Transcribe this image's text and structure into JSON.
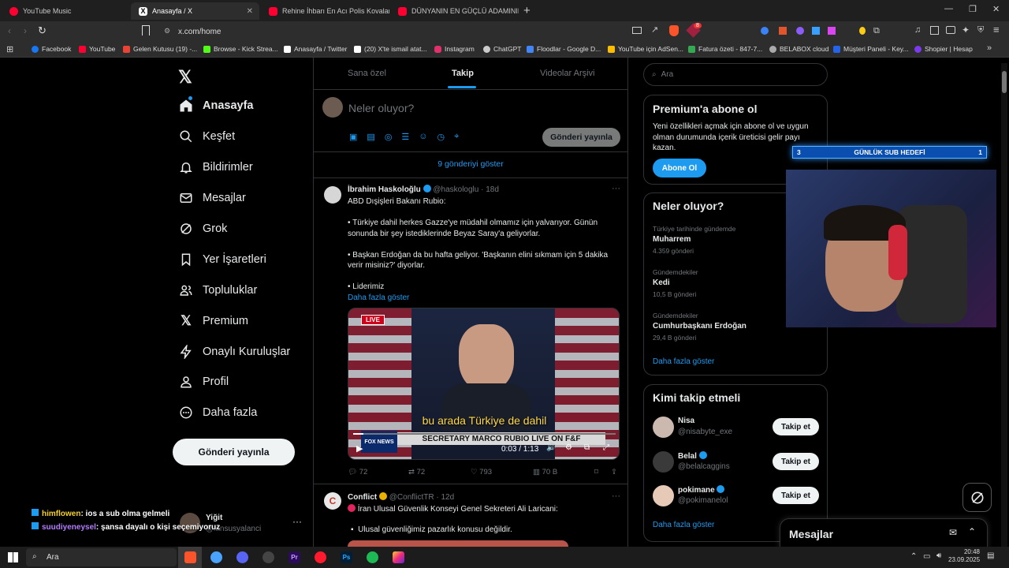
{
  "browser": {
    "tabs": [
      {
        "label": "YouTube Music",
        "color": "#ff0033"
      },
      {
        "label": "Anasayfa / X",
        "color": "#ffffff"
      },
      {
        "label": "Rehine İhbarı En Acı Polis Kovalamac",
        "color": "#ff0033"
      },
      {
        "label": "DÜNYANIN EN GÜÇLÜ ADAMININ AF",
        "color": "#ff0033"
      }
    ],
    "url": "x.com/home",
    "notif_count": "8",
    "bookmarks": [
      "Facebook",
      "YouTube",
      "Gelen Kutusu (19) -...",
      "Browse - Kick Strea...",
      "Anasayfa / Twitter",
      "(20) X'te ismail atat...",
      "Instagram",
      "ChatGPT",
      "Floodlar - Google D...",
      "YouTube için AdSen...",
      "Fatura özeti - 847-7...",
      "BELABOX cloud",
      "Müşteri Paneli - Key...",
      "Shopier | Hesap"
    ]
  },
  "nav": {
    "items": [
      {
        "label": "Anasayfa",
        "icon": "home-icon"
      },
      {
        "label": "Keşfet",
        "icon": "search-icon"
      },
      {
        "label": "Bildirimler",
        "icon": "bell-icon"
      },
      {
        "label": "Mesajlar",
        "icon": "mail-icon"
      },
      {
        "label": "Grok",
        "icon": "grok-icon"
      },
      {
        "label": "Yer İşaretleri",
        "icon": "bookmark-icon"
      },
      {
        "label": "Topluluklar",
        "icon": "people-icon"
      },
      {
        "label": "Premium",
        "icon": "x-logo-icon"
      },
      {
        "label": "Onaylı Kuruluşlar",
        "icon": "lightning-icon"
      },
      {
        "label": "Profil",
        "icon": "person-icon"
      },
      {
        "label": "Daha fazla",
        "icon": "more-circle-icon"
      }
    ],
    "post_button": "Gönderi yayınla",
    "account": {
      "name": "Yiğit",
      "handle": "@lansusyalanci"
    }
  },
  "chat_overlay": [
    {
      "user": "himflowen",
      "text": ": ios a sub olma gelmeli",
      "color": "#f5d020"
    },
    {
      "user": "suudiyeneysel",
      "text": ": şansa dayalı o kişi seçemiyoruz",
      "color": "#b47cff"
    }
  ],
  "feed": {
    "tabs": [
      "Sana özel",
      "Takip",
      "Videolar Arşivi"
    ],
    "compose_placeholder": "Neler oluyor?",
    "compose_button": "Gönderi yayınla",
    "show_more_posts": "9 gönderiyi göster",
    "post1": {
      "name": "İbrahim Haskoloğlu",
      "handle": "@haskologlu",
      "time": "· 18d",
      "lines": [
        "ABD Dışişleri Bakanı Rubio:",
        "• Türkiye dahil herkes Gazze'ye müdahil olmamız için yalvarıyor. Günün",
        "sonunda bir şey istediklerinde Beyaz Saray'a geliyorlar.",
        "• Başkan Erdoğan da bu hafta geliyor. 'Başkanın elini sıkmam için 5 dakika",
        "verir misiniz?' diyorlar.",
        "• Liderimiz"
      ],
      "show_more": "Daha fazla göster",
      "video": {
        "live_badge": "LIVE",
        "subtitle": "bu arada Türkiye de dahil",
        "lower_third": "SECRETARY MARCO RUBIO LIVE ON F&F",
        "channel": "FOX NEWS",
        "time": "0:03 / 1:13",
        "progress": 0.04
      },
      "stats": {
        "replies": "72",
        "reposts": "72",
        "likes": "793",
        "views": "70 B"
      }
    },
    "post2": {
      "name": "Conflict",
      "handle": "@ConflictTR",
      "time": "· 12d",
      "line1": "İran Ulusal Güvenlik Konseyi Genel Sekreteri Ali Laricani:",
      "line2": "Ulusal güvenliğimiz pazarlık konusu değildir."
    }
  },
  "right": {
    "search_placeholder": "Ara",
    "premium": {
      "title": "Premium'a abone ol",
      "text": [
        "Yeni özellikleri açmak için abone ol ve uygun",
        "olman durumunda içerik üreticisi gelir payı",
        "kazan."
      ],
      "button": "Abone Ol"
    },
    "trends": {
      "title": "Neler oluyor?",
      "items": [
        {
          "context": "Türkiye tarihinde gündemde",
          "name": "Muharrem",
          "count": "4.359 gönderi"
        },
        {
          "context": "Gündemdekiler",
          "name": "Kedi",
          "count": "10,5 B gönderi"
        },
        {
          "context": "Gündemdekiler",
          "name": "Cumhurbaşkanı Erdoğan",
          "count": "29,4 B gönderi"
        }
      ],
      "more": "Daha fazla göster"
    },
    "who_to_follow": {
      "title": "Kimi takip etmeli",
      "users": [
        {
          "name": "Nisa",
          "handle": "@nisabyte_exe",
          "verified": false
        },
        {
          "name": "Belal",
          "handle": "@belalcaggins",
          "verified": true
        },
        {
          "name": "pokimane",
          "handle": "@pokimanelol",
          "verified": true
        }
      ],
      "button": "Takip et",
      "more": "Daha fazla göster"
    },
    "messages_drawer": "Mesajlar"
  },
  "overlay": {
    "goal_label": "GÜNLÜK SUB HEDEFİ",
    "goal_left": "3",
    "goal_right": "1"
  },
  "taskbar": {
    "search": "Ara",
    "time": "20:48",
    "date": "23.09.2025"
  }
}
